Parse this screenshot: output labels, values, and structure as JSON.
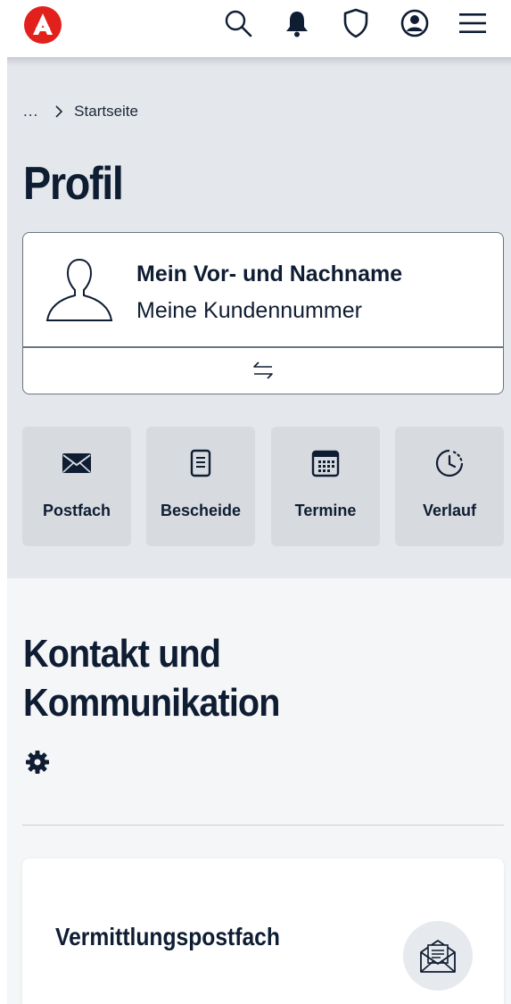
{
  "header": {
    "logo_icon": "agentur-fuer-arbeit-logo",
    "icons": [
      "search-icon",
      "bell-icon",
      "shield-icon",
      "account-icon",
      "menu-icon"
    ],
    "brand_color": "#e2211c"
  },
  "breadcrumb": {
    "ellipsis": "...",
    "current": "Startseite"
  },
  "page": {
    "title": "Profil"
  },
  "profile": {
    "name": "Mein Vor- und Nachname",
    "customer_number": "Meine Kundennummer",
    "switch_icon": "swap-arrows-icon"
  },
  "tiles": [
    {
      "label": "Postfach",
      "icon": "envelope-icon"
    },
    {
      "label": "Bescheide",
      "icon": "document-icon"
    },
    {
      "label": "Termine",
      "icon": "calendar-icon"
    },
    {
      "label": "Verlauf",
      "icon": "clock-history-icon"
    }
  ],
  "contact": {
    "title": "Kontakt und Kommunikation",
    "settings_icon": "gear-icon"
  },
  "inbox_card": {
    "title": "Vermittlungspostfach",
    "icon": "open-envelope-icon"
  },
  "colors": {
    "text": "#0f1d33",
    "gray_bg": "#e4e7eb",
    "tile_bg": "#d7dbe0"
  }
}
